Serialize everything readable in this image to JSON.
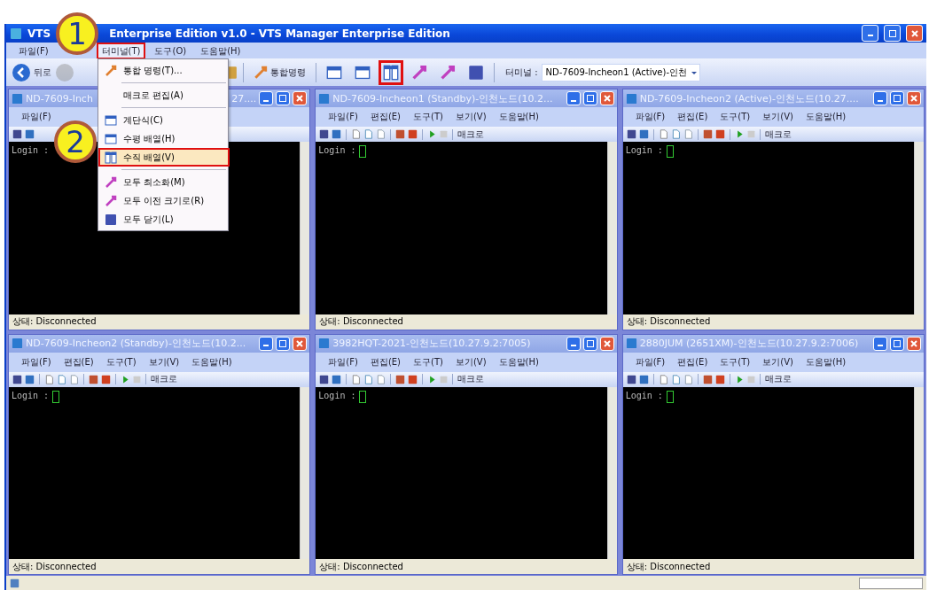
{
  "window": {
    "title_start": "VTS",
    "title_end": "Enterprise Edition v1.0 - VTS Manager Enterprise Edition"
  },
  "menu_bar": [
    {
      "label": "파일(F)",
      "selected": false,
      "highlighted": false
    },
    {
      "label": "터미널(T)",
      "selected": true,
      "highlighted": true
    },
    {
      "label": "도구(O)",
      "selected": false,
      "highlighted": false
    },
    {
      "label": "도움말(H)",
      "selected": false,
      "highlighted": false
    }
  ],
  "toolbar": {
    "back": "뒤로",
    "command": "통합명령",
    "tile_vertical_highlighted": true,
    "terminal_label": "터미널 :",
    "terminal_value": "ND-7609-Incheon1 (Active)-인천"
  },
  "terminal_menu": [
    {
      "kind": "item",
      "label": "통합 명령(T)...",
      "selected": false,
      "highlighted": false
    },
    {
      "kind": "separator"
    },
    {
      "kind": "item",
      "label": "매크로 편집(A)",
      "selected": false,
      "highlighted": false
    },
    {
      "kind": "separator"
    },
    {
      "kind": "item",
      "label": "계단식(C)",
      "selected": false,
      "highlighted": false
    },
    {
      "kind": "item",
      "label": "수평 배열(H)",
      "selected": false,
      "highlighted": false
    },
    {
      "kind": "item",
      "label": "수직 배열(V)",
      "selected": true,
      "highlighted": true
    },
    {
      "kind": "separator"
    },
    {
      "kind": "item",
      "label": "모두 최소화(M)",
      "selected": false,
      "highlighted": false
    },
    {
      "kind": "item",
      "label": "모두 이전 크기로(R)",
      "selected": false,
      "highlighted": false
    },
    {
      "kind": "item",
      "label": "모두 닫기(L)",
      "selected": false,
      "highlighted": false
    }
  ],
  "callouts": [
    {
      "label": "1"
    },
    {
      "label": "2"
    }
  ],
  "child_windows": [
    {
      "title": "ND-7609-Inch",
      "title_tail": "27....",
      "covered": true,
      "menu": [
        "파일(F)"
      ],
      "prompt": "Login :",
      "status": "상태: Disconnected"
    },
    {
      "title": "ND-7609-Incheon1 (Standby)-인천노드(10.2...",
      "covered": false,
      "menu": [
        "파일(F)",
        "편집(E)",
        "도구(T)",
        "보기(V)",
        "도움말(H)"
      ],
      "macro": "매크로",
      "prompt": "Login :",
      "status": "상태: Disconnected"
    },
    {
      "title": "ND-7609-Incheon2 (Active)-인천노드(10.27....",
      "covered": false,
      "menu": [
        "파일(F)",
        "편집(E)",
        "도구(T)",
        "보기(V)",
        "도움말(H)"
      ],
      "macro": "매크로",
      "prompt": "Login :",
      "status": "상태: Disconnected"
    },
    {
      "title": "ND-7609-Incheon2 (Standby)-인천노드(10.2...",
      "covered": false,
      "menu": [
        "파일(F)",
        "편집(E)",
        "도구(T)",
        "보기(V)",
        "도움말(H)"
      ],
      "macro": "매크로",
      "prompt": "Login :",
      "status": "상태: Disconnected"
    },
    {
      "title": "3982HQT-2021-인천노드(10.27.9.2:7005)",
      "covered": false,
      "menu": [
        "파일(F)",
        "편집(E)",
        "도구(T)",
        "보기(V)",
        "도움말(H)"
      ],
      "macro": "매크로",
      "prompt": "Login :",
      "status": "상태: Disconnected"
    },
    {
      "title": "2880JUM (2651XM)-인천노드(10.27.9.2:7006)",
      "covered": false,
      "menu": [
        "파일(F)",
        "편집(E)",
        "도구(T)",
        "보기(V)",
        "도움말(H)"
      ],
      "macro": "매크로",
      "prompt": "Login :",
      "status": "상태: Disconnected"
    }
  ]
}
